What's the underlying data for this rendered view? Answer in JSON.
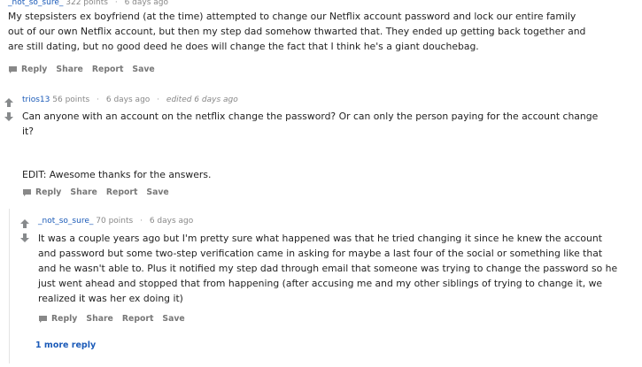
{
  "comments": [
    {
      "username": "_not_so_sure_",
      "points": "322 points",
      "time": "6 days ago",
      "body": [
        "My stepsisters ex boyfriend (at the time) attempted to change our Netflix account password and lock our entire family",
        "out of our own Netflix account, but then my step dad somehow thwarted that. They ended up getting back together and",
        "are still dating, but no good deed he does will change the fact that I think he's a giant douchebag."
      ],
      "actions": [
        "Reply",
        "Share",
        "Report",
        "Save"
      ]
    },
    {
      "username": "trios13",
      "points": "56 points",
      "time": "6 days ago",
      "edited": "edited 6 days ago",
      "body": [
        "Can anyone with an account on the netflix change the password? Or can only the person paying for the account change",
        "it?",
        "",
        "EDIT: Awesome thanks for the answers."
      ],
      "actions": [
        "Reply",
        "Share",
        "Report",
        "Save"
      ]
    },
    {
      "username": "_not_so_sure_",
      "points": "70 points",
      "time": "6 days ago",
      "body": [
        "It was a couple years ago but I'm pretty sure what happened was that he tried changing it since he knew the account",
        "and password but some two-step verification came in asking for maybe a last four of the social or something like that",
        "and he wasn't able to. Plus it notified my step dad through email that someone was trying to change the password so he",
        "just went ahead and stopped that from happening (after accusing me and my other siblings of trying to change it, we",
        "realized it was her ex doing it)"
      ],
      "actions": [
        "Reply",
        "Share",
        "Report",
        "Save"
      ]
    }
  ],
  "more_replies": "1 more reply",
  "icons": {
    "upvote": "upvote-arrow-icon",
    "downvote": "downvote-arrow-icon",
    "reply": "reply-speech-bubble-icon"
  },
  "colors": {
    "username": "#1a5ab8",
    "meta": "#888888",
    "action": "#777777",
    "vote_arrow": "#878a8c"
  }
}
